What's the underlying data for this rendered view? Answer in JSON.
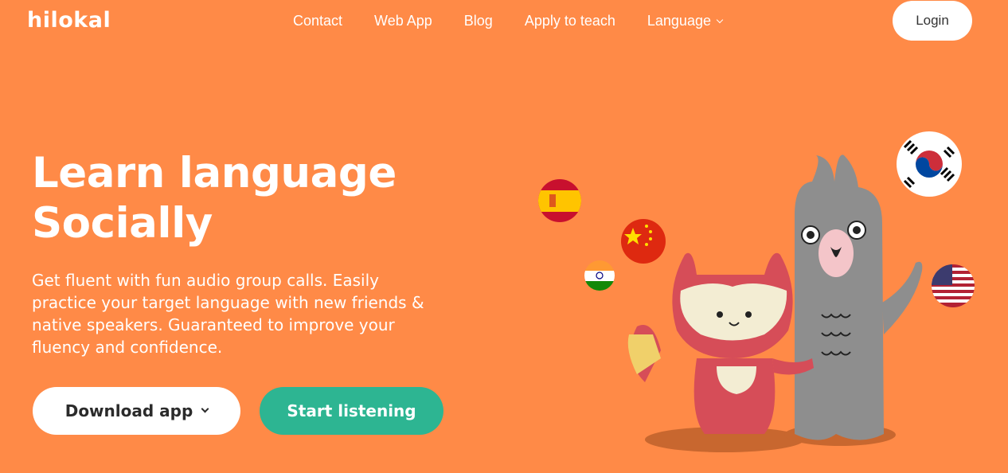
{
  "brand": {
    "logo_text": "hilokal"
  },
  "nav": {
    "items": [
      "Contact",
      "Web App",
      "Blog",
      "Apply to teach"
    ],
    "language_label": "Language"
  },
  "login_label": "Login",
  "hero": {
    "headline_line1": "Learn language",
    "headline_line2": "Socially",
    "subtitle": "Get fluent with fun audio group calls. Easily practice your target language with new friends & native speakers. Guaranteed to improve your fluency and confidence.",
    "download_label": "Download app",
    "listen_label": "Start listening"
  },
  "illustration": {
    "characters": [
      "fox-mascot",
      "llama-mascot"
    ],
    "flags": [
      "spain-flag-icon",
      "china-flag-icon",
      "india-flag-icon",
      "korea-flag-icon",
      "usa-flag-icon"
    ]
  },
  "colors": {
    "background": "#FF8A47",
    "primary_button": "#2DB592",
    "fox": "#D64D58",
    "llama": "#8E8E8E"
  }
}
